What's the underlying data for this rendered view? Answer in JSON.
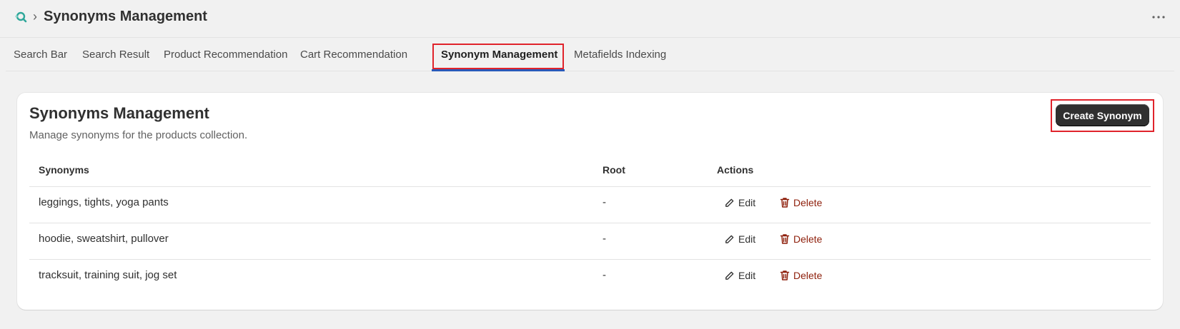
{
  "header": {
    "breadcrumb_separator": "›",
    "title": "Synonyms Management"
  },
  "tabs": [
    {
      "label": "Search Bar",
      "active": false
    },
    {
      "label": "Search Result",
      "active": false
    },
    {
      "label": "Product Recommendation",
      "active": false
    },
    {
      "label": "Cart Recommendation",
      "active": false
    },
    {
      "label": "Synonym Management",
      "active": true
    },
    {
      "label": "Metafields Indexing",
      "active": false
    }
  ],
  "card": {
    "title": "Synonyms Management",
    "subtitle": "Manage synonyms for the products collection.",
    "create_button_label": "Create Synonym"
  },
  "table": {
    "columns": [
      "Synonyms",
      "Root",
      "Actions"
    ],
    "rows": [
      {
        "synonyms": "leggings, tights, yoga pants",
        "root": "-",
        "edit": "Edit",
        "delete": "Delete"
      },
      {
        "synonyms": "hoodie, sweatshirt, pullover",
        "root": "-",
        "edit": "Edit",
        "delete": "Delete"
      },
      {
        "synonyms": "tracksuit, training suit, jog set",
        "root": "-",
        "edit": "Edit",
        "delete": "Delete"
      }
    ]
  },
  "icons": {
    "app_logo": "search-app-logo-icon",
    "more": "more-horizontal-icon",
    "edit": "pencil-icon",
    "delete": "trash-icon"
  },
  "colors": {
    "primary_button": "#303030",
    "delete": "#8e1f0b",
    "active_tab_underline": "#2a59b8",
    "highlight_box": "#e0232b"
  }
}
